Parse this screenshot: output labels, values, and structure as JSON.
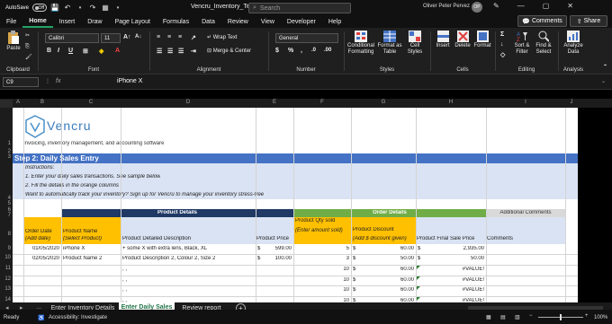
{
  "titlebar": {
    "autosave": "AutoSave",
    "autosave_state": "Off",
    "filename": "Vencru_Inventory_Templat...",
    "search_placeholder": "Search",
    "user": "Oliver Peter Pervez",
    "avatar_initials": "OP"
  },
  "menu": [
    "File",
    "Home",
    "Insert",
    "Draw",
    "Page Layout",
    "Formulas",
    "Data",
    "Review",
    "View",
    "Developer",
    "Help"
  ],
  "actions": {
    "comments": "Comments",
    "share": "Share"
  },
  "ribbon": {
    "clipboard": {
      "paste": "Paste",
      "label": "Clipboard"
    },
    "font": {
      "name": "Calibri",
      "size": "11",
      "label": "Font",
      "bold": "B",
      "italic": "I",
      "underline": "U"
    },
    "alignment": {
      "wrap": "Wrap Text",
      "merge": "Merge & Center",
      "label": "Alignment"
    },
    "number": {
      "format": "General",
      "label": "Number"
    },
    "styles": {
      "conditional": "Conditional Formatting",
      "format_table": "Format as Table",
      "cell_styles": "Cell Styles",
      "label": "Styles"
    },
    "cells": {
      "insert": "Insert",
      "delete": "Delete",
      "format": "Format",
      "label": "Cells"
    },
    "editing": {
      "sort": "Sort & Filter",
      "find": "Find & Select",
      "label": "Editing"
    },
    "analysis": {
      "analyze": "Analyze Data",
      "label": "Analysis"
    }
  },
  "formula": {
    "namebox": "C9",
    "fx": "fx",
    "value": "iPhone X"
  },
  "columns": [
    "A",
    "B",
    "C",
    "D",
    "E",
    "F",
    "G",
    "H",
    "I",
    "J"
  ],
  "rows": [
    "1",
    "2",
    "3",
    "4",
    "5",
    "6",
    "7",
    "8",
    "9",
    "10",
    "11",
    "12",
    "13",
    "14"
  ],
  "sheet": {
    "logo": "Vencru",
    "tagline": "Invoicing, inventory management, and accounting software",
    "step": "Step 2: Daily Sales Entry",
    "instructions": [
      "Instructions:",
      "1. Enter your daily sales transactions. See sample below",
      "2. Fill the details in the orange columns",
      "Want to automatically track your inventory? Sign up for Vencru to manage your inventory stress-free"
    ],
    "groups": {
      "product_details": "Product Details",
      "order_details": "Order Details",
      "additional": "Additional Comments"
    },
    "headers": {
      "order_date": "Order Date",
      "order_date_sub": "(Add date)",
      "product_name": "Product Name",
      "product_name_sub": "(Select Product)",
      "desc": "Product Detailed Description",
      "price": "Product Price",
      "qty": "Product Qty sold",
      "qty_sub": "(Enter amount sold)",
      "discount": "Product Discount",
      "discount_sub": "(Add $ discount given)",
      "final": "Product Final Sale Price",
      "comments": "Comments"
    },
    "data": [
      {
        "date": "01/05/2020",
        "name": "iPhone X",
        "desc": "+ some X with extra lens, Black, XL",
        "price_sym": "$",
        "price": "599.00",
        "qty": "5",
        "disc_sym": "$",
        "disc": "60.00",
        "final_sym": "$",
        "final": "2,935.00"
      },
      {
        "date": "02/05/2020",
        "name": "Product Name 2",
        "desc": "Product Description 2, Colour 2, Size 2",
        "price_sym": "$",
        "price": "100.00",
        "qty": "3",
        "disc_sym": "$",
        "disc": "50.00",
        "final_sym": "$",
        "final": "50.00"
      },
      {
        "date": "",
        "name": "",
        "desc": ", ,",
        "price_sym": "",
        "price": "",
        "qty": "10",
        "disc_sym": "$",
        "disc": "60.00",
        "final_sym": "",
        "final": "#VALUE!"
      },
      {
        "date": "",
        "name": "",
        "desc": ", ,",
        "price_sym": "",
        "price": "",
        "qty": "10",
        "disc_sym": "$",
        "disc": "60.00",
        "final_sym": "",
        "final": "#VALUE!"
      },
      {
        "date": "",
        "name": "",
        "desc": ", ,",
        "price_sym": "",
        "price": "",
        "qty": "10",
        "disc_sym": "$",
        "disc": "60.00",
        "final_sym": "",
        "final": "#VALUE!"
      },
      {
        "date": "",
        "name": "",
        "desc": ", ,",
        "price_sym": "",
        "price": "",
        "qty": "10",
        "disc_sym": "$",
        "disc": "60.00",
        "final_sym": "",
        "final": "#VALUE!"
      }
    ]
  },
  "tabs": [
    "Enter Inventory Details",
    "Enter Daily Sales",
    "Review report"
  ],
  "status": {
    "ready": "Ready",
    "accessibility": "Accessibility: Investigate",
    "zoom": "100%"
  },
  "colors": {
    "accent": "#21a366",
    "blue": "#4472c4",
    "navy": "#1f3864",
    "green": "#70ad47",
    "orange": "#ffc000",
    "band": "#dae3f3",
    "grey": "#d9d9d9"
  }
}
